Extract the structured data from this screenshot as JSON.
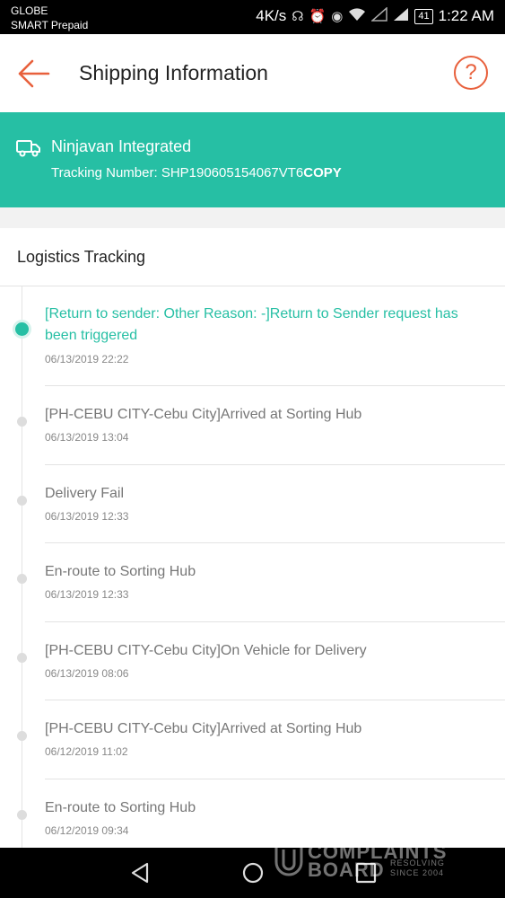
{
  "status_bar": {
    "carrier_line1": "GLOBE",
    "carrier_line2": "SMART Prepaid",
    "network_speed": "4K/s",
    "battery": "41",
    "time": "1:22 AM"
  },
  "header": {
    "title": "Shipping Information",
    "back_icon": "arrow-left-icon",
    "help_icon": "question-mark-icon",
    "help_glyph": "?"
  },
  "shipping": {
    "carrier_name": "Ninjavan Integrated",
    "tracking_label": "Tracking Number: SHP190605154067VT6",
    "copy_label": "COPY",
    "truck_icon": "truck-icon"
  },
  "logistics": {
    "title": "Logistics Tracking",
    "events": [
      {
        "text": "[Return to sender: Other Reason: -]Return to Sender request has been triggered",
        "time": "06/13/2019 22:22",
        "active": true
      },
      {
        "text": "[PH-CEBU CITY-Cebu City]Arrived at Sorting Hub",
        "time": "06/13/2019 13:04",
        "active": false
      },
      {
        "text": "Delivery Fail",
        "time": "06/13/2019 12:33",
        "active": false
      },
      {
        "text": "En-route to Sorting Hub",
        "time": "06/13/2019 12:33",
        "active": false
      },
      {
        "text": "[PH-CEBU CITY-Cebu City]On Vehicle for Delivery",
        "time": "06/13/2019 08:06",
        "active": false
      },
      {
        "text": "[PH-CEBU CITY-Cebu City]Arrived at Sorting Hub",
        "time": "06/12/2019 11:02",
        "active": false
      },
      {
        "text": "En-route to Sorting Hub",
        "time": "06/12/2019 09:34",
        "active": false
      }
    ]
  },
  "watermark": {
    "line1": "COMPLAINTS",
    "line2": "BOARD",
    "tag1": "RESOLVING",
    "tag2": "SINCE 2004"
  },
  "nav_bar": {
    "back_icon": "triangle-back-icon",
    "home_icon": "circle-home-icon",
    "recents_icon": "square-recents-icon"
  },
  "colors": {
    "accent": "#26bfa4",
    "brand_orange": "#e8603c"
  }
}
